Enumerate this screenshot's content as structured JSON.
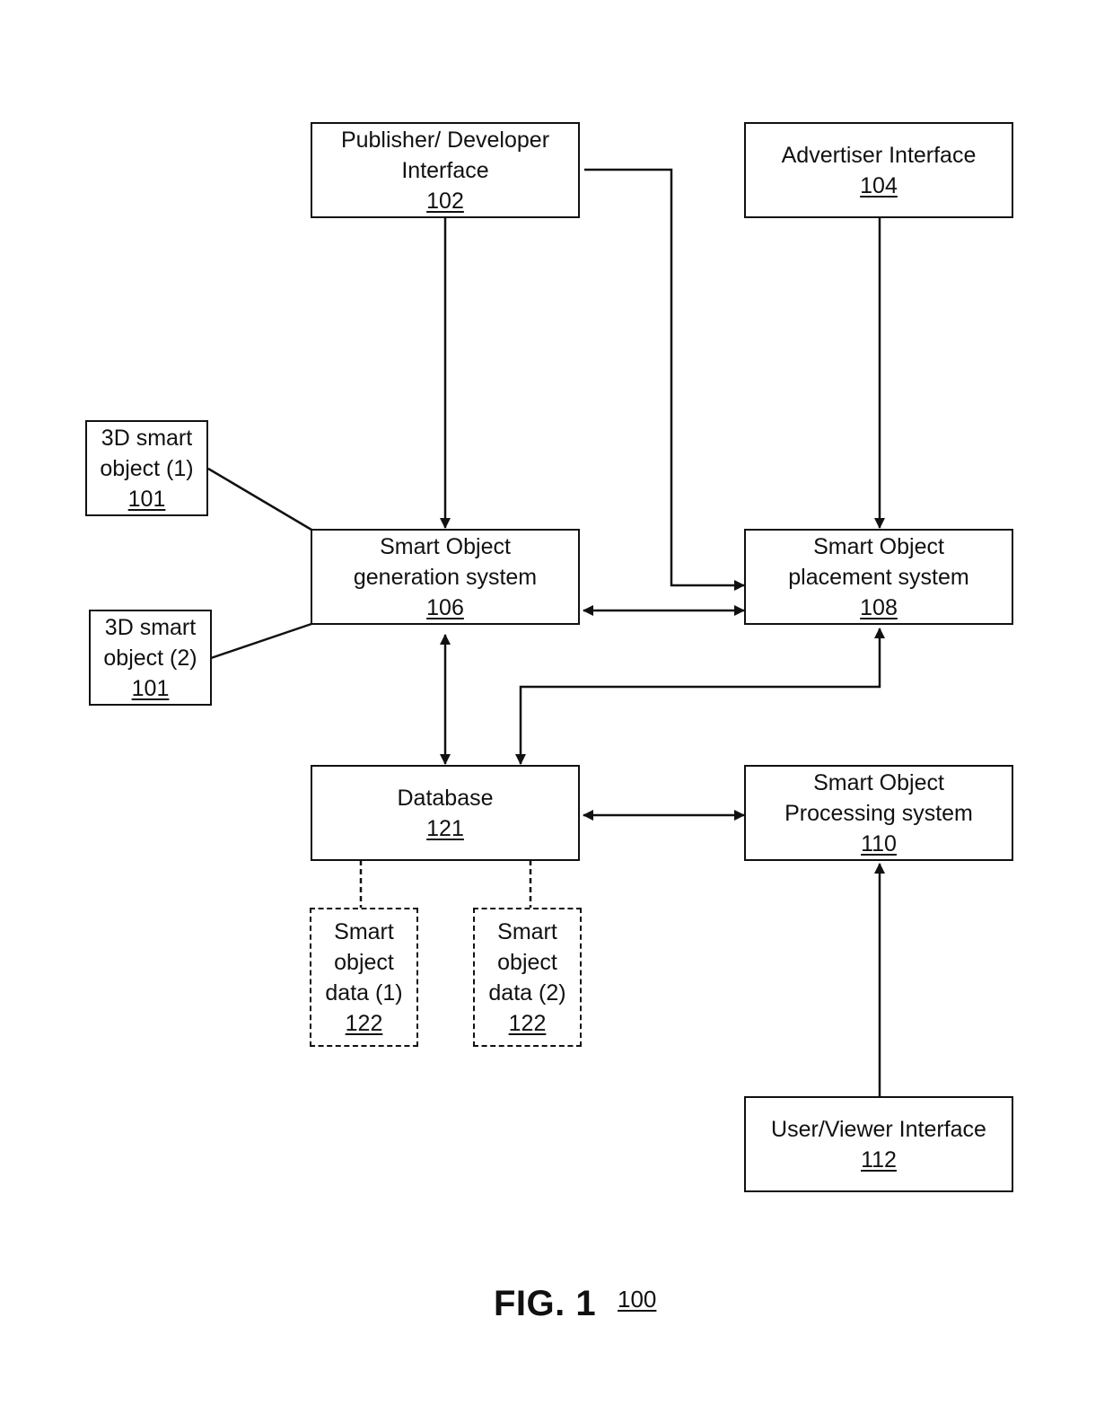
{
  "nodes": {
    "publisher": {
      "lines": [
        "Publisher/ Developer",
        "Interface"
      ],
      "ref": "102"
    },
    "advertiser": {
      "lines": [
        "Advertiser Interface"
      ],
      "ref": "104"
    },
    "obj1": {
      "lines": [
        "3D smart",
        "object (1)"
      ],
      "ref": "101"
    },
    "obj2": {
      "lines": [
        "3D smart",
        "object (2)"
      ],
      "ref": "101"
    },
    "generation": {
      "lines": [
        "Smart Object",
        "generation system"
      ],
      "ref": "106"
    },
    "placement": {
      "lines": [
        "Smart Object",
        "placement system"
      ],
      "ref": "108"
    },
    "database": {
      "lines": [
        "Database"
      ],
      "ref": "121"
    },
    "processing": {
      "lines": [
        "Smart Object",
        "Processing system"
      ],
      "ref": "110"
    },
    "data1": {
      "lines": [
        "Smart",
        "object",
        "data (1)"
      ],
      "ref": "122"
    },
    "data2": {
      "lines": [
        "Smart",
        "object",
        "data (2)"
      ],
      "ref": "122"
    },
    "viewer": {
      "lines": [
        "User/Viewer Interface"
      ],
      "ref": "112"
    }
  },
  "edges": [
    {
      "from": "publisher",
      "to": "generation",
      "type": "arrow"
    },
    {
      "from": "publisher",
      "to": "placement",
      "type": "arrow"
    },
    {
      "from": "advertiser",
      "to": "placement",
      "type": "arrow"
    },
    {
      "from": "obj1",
      "to": "generation",
      "type": "line"
    },
    {
      "from": "obj2",
      "to": "generation",
      "type": "line"
    },
    {
      "from": "generation",
      "to": "placement",
      "type": "bidirectional"
    },
    {
      "from": "generation",
      "to": "database",
      "type": "bidirectional"
    },
    {
      "from": "database",
      "to": "placement",
      "type": "bidirectional"
    },
    {
      "from": "database",
      "to": "processing",
      "type": "bidirectional"
    },
    {
      "from": "viewer",
      "to": "processing",
      "type": "arrow"
    },
    {
      "from": "database",
      "to": "data1",
      "type": "dashed"
    },
    {
      "from": "database",
      "to": "data2",
      "type": "dashed"
    }
  ],
  "caption": {
    "label": "FIG. 1",
    "ref": "100"
  }
}
